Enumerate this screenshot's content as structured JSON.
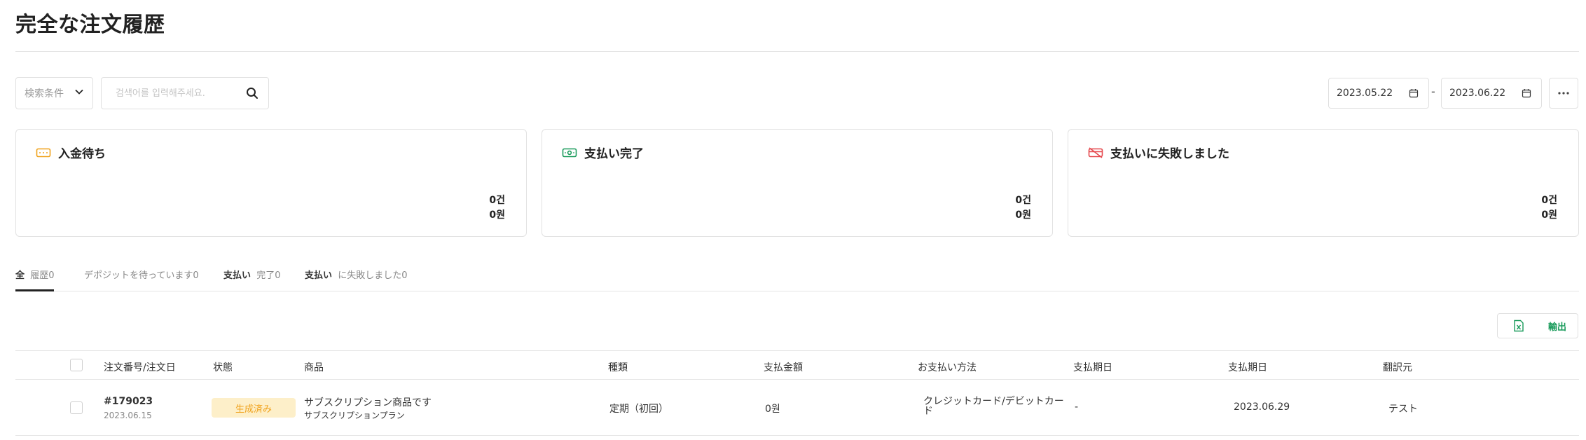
{
  "page": {
    "title": "完全な注文履歴"
  },
  "filters": {
    "search_condition_label": "検索条件",
    "search_placeholder": "검색어를 입력해주세요.",
    "date_from": "2023.05.22",
    "date_to": "2023.06.22",
    "date_separator": "-"
  },
  "summary_cards": [
    {
      "title": "入金待ち",
      "count": "0건",
      "amount": "0원",
      "icon": "card-pending-icon",
      "color": "#f0a21b"
    },
    {
      "title": "支払い完了",
      "count": "0건",
      "amount": "0원",
      "icon": "cash-icon",
      "color": "#1a9b5b"
    },
    {
      "title": "支払いに失敗しました",
      "count": "0건",
      "amount": "0원",
      "icon": "card-failed-icon",
      "color": "#e5484d"
    }
  ],
  "tabs": [
    {
      "prefix": "全",
      "label": "履歴0"
    },
    {
      "prefix": "",
      "label": "デポジットを待っています0"
    },
    {
      "prefix": "支払い",
      "label": "完了0"
    },
    {
      "prefix": "支払い",
      "label": "に失敗しました0"
    }
  ],
  "toolbar": {
    "export_label": "輸出"
  },
  "table": {
    "columns": [
      "注文番号/注文日",
      "状態",
      "商品",
      "種類",
      "支払金額",
      "お支払い方法",
      "支払期日",
      "支払期日",
      "翻訳元"
    ],
    "rows": [
      {
        "order_no": "#179023",
        "order_date": "2023.06.15",
        "status": "生成済み",
        "product_name": "サブスクリプション商品です",
        "product_plan": "サブスクリプションプラン",
        "type": "定期（初回）",
        "amount": "0원",
        "payment_method_line1": "クレジットカード/デビットカー",
        "payment_method_line2": "ド",
        "due_date_1": "-",
        "due_date_2": "2023.06.29",
        "source": "テスト"
      }
    ]
  },
  "colors": {
    "accent_green": "#1a9b5b",
    "pending_orange": "#f0a21b",
    "failed_red": "#e5484d",
    "badge_bg": "#fdefc9"
  }
}
